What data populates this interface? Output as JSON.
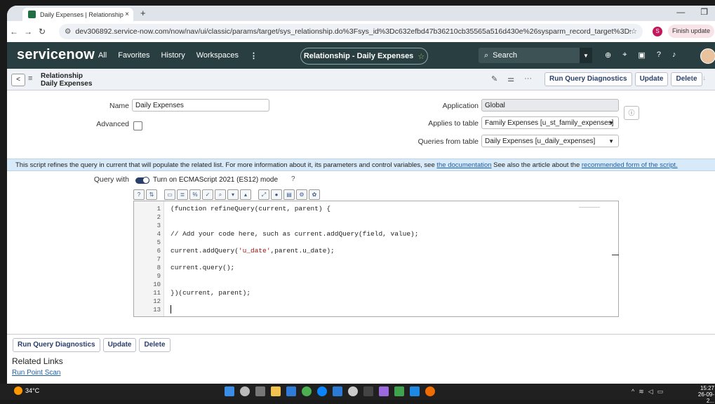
{
  "browser": {
    "tab_title": "Daily Expenses | Relationship | S",
    "tab_close": "×",
    "new_tab": "+",
    "url": "dev306892.service-now.com/now/nav/ui/classic/params/target/sys_relationship.do%3Fsys_id%3Dc632efbd47b36210cb35565a516d430e%26sysparm_record_target%3Dsys_relationship%26...",
    "profile_initial": "S",
    "finish_update": "Finish update",
    "window_controls": [
      "—",
      "❐"
    ]
  },
  "header": {
    "logo": "servicenow",
    "menu": [
      "All",
      "Favorites",
      "History",
      "Workspaces"
    ],
    "menu_more": "⋮",
    "context_pill": "Relationship - Daily Expenses",
    "search_placeholder": "Search"
  },
  "form_header": {
    "title_line1": "Relationship",
    "title_line2": "Daily Expenses",
    "buttons": {
      "diagnostics": "Run Query Diagnostics",
      "update": "Update",
      "delete": "Delete"
    }
  },
  "fields": {
    "name_label": "Name",
    "name_value": "Daily Expenses",
    "advanced_label": "Advanced",
    "application_label": "Application",
    "application_value": "Global",
    "applies_label": "Applies to table",
    "applies_value": "Family Expenses [u_st_family_expenses]",
    "queries_label": "Queries from table",
    "queries_value": "Daily Expenses [u_daily_expenses]"
  },
  "notice": {
    "text_before": "This script refines the query in current that will populate the related list. For more information about it, its parameters and control variables, see ",
    "link1": "the documentation",
    "text_mid": " See also the article about the ",
    "link2": "recommended form of the script."
  },
  "query": {
    "label": "Query with",
    "toggle_text": "Turn on ECMAScript 2021 (ES12) mode"
  },
  "editor": {
    "line_numbers": [
      "1",
      "2",
      "3",
      "4",
      "5",
      "6",
      "7",
      "8",
      "9",
      "10",
      "11",
      "12",
      "13"
    ],
    "lines": [
      "(function refineQuery(current, parent) {",
      "",
      "",
      "// Add your code here, such as current.addQuery(field, value);",
      "",
      "current.addQuery('u_date',parent.u_date);",
      "",
      "current.query();",
      "",
      "",
      "})(current, parent);",
      "",
      ""
    ]
  },
  "bottom": {
    "diagnostics": "Run Query Diagnostics",
    "update": "Update",
    "delete": "Delete",
    "related_links": "Related Links",
    "run_point_scan": "Run Point Scan"
  },
  "taskbar": {
    "temperature": "34°C",
    "time": "15:27",
    "date": "26-09-2..."
  },
  "colors": {
    "sn_header": "#293e40",
    "accent": "#293e6a",
    "notice_bg": "#d8eaf8"
  }
}
